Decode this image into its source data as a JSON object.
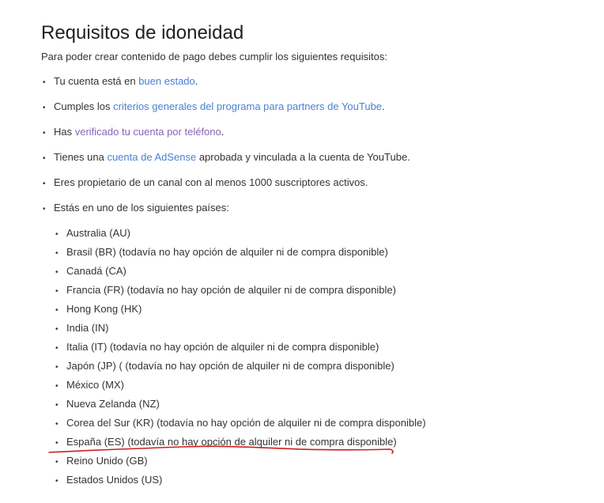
{
  "title": "Requisitos de idoneidad",
  "intro": "Para poder crear contenido de pago debes cumplir los siguientes requisitos:",
  "requirements": [
    {
      "pre": "Tu cuenta está en ",
      "link": "buen estado",
      "post": "."
    },
    {
      "pre": "Cumples los ",
      "link": "criterios generales del programa para partners de YouTube",
      "post": "."
    },
    {
      "pre": "Has ",
      "link": "verificado tu cuenta por teléfono",
      "post": "."
    },
    {
      "pre": "Tienes una ",
      "link": "cuenta de AdSense",
      "post": " aprobada y vinculada a la cuenta de YouTube."
    },
    {
      "text": "Eres propietario de un canal con al menos 1000 suscriptores activos."
    },
    {
      "text": "Estás en uno de los siguientes países:"
    }
  ],
  "countries": [
    "Australia (AU)",
    "Brasil (BR) (todavía no hay opción de alquiler ni de compra disponible)",
    "Canadá (CA)",
    "Francia (FR) (todavía no hay opción de alquiler ni de compra disponible)",
    "Hong Kong (HK)",
    "India (IN)",
    "Italia (IT) (todavía no hay opción de alquiler ni de compra disponible)",
    "Japón (JP) ( (todavía no hay opción de alquiler ni de compra disponible)",
    "México (MX)",
    "Nueva Zelanda (NZ)",
    "Corea del Sur (KR) (todavía no hay opción de alquiler ni de compra disponible)",
    "España (ES) (todavía no hay opción de alquiler ni de compra disponible)",
    "Reino Unido (GB)",
    "Estados Unidos (US)"
  ],
  "bullet": "•",
  "colors": {
    "link": "#4a7fd4",
    "visited_link": "#8a62b7",
    "annotation": "#cc1f1f"
  }
}
